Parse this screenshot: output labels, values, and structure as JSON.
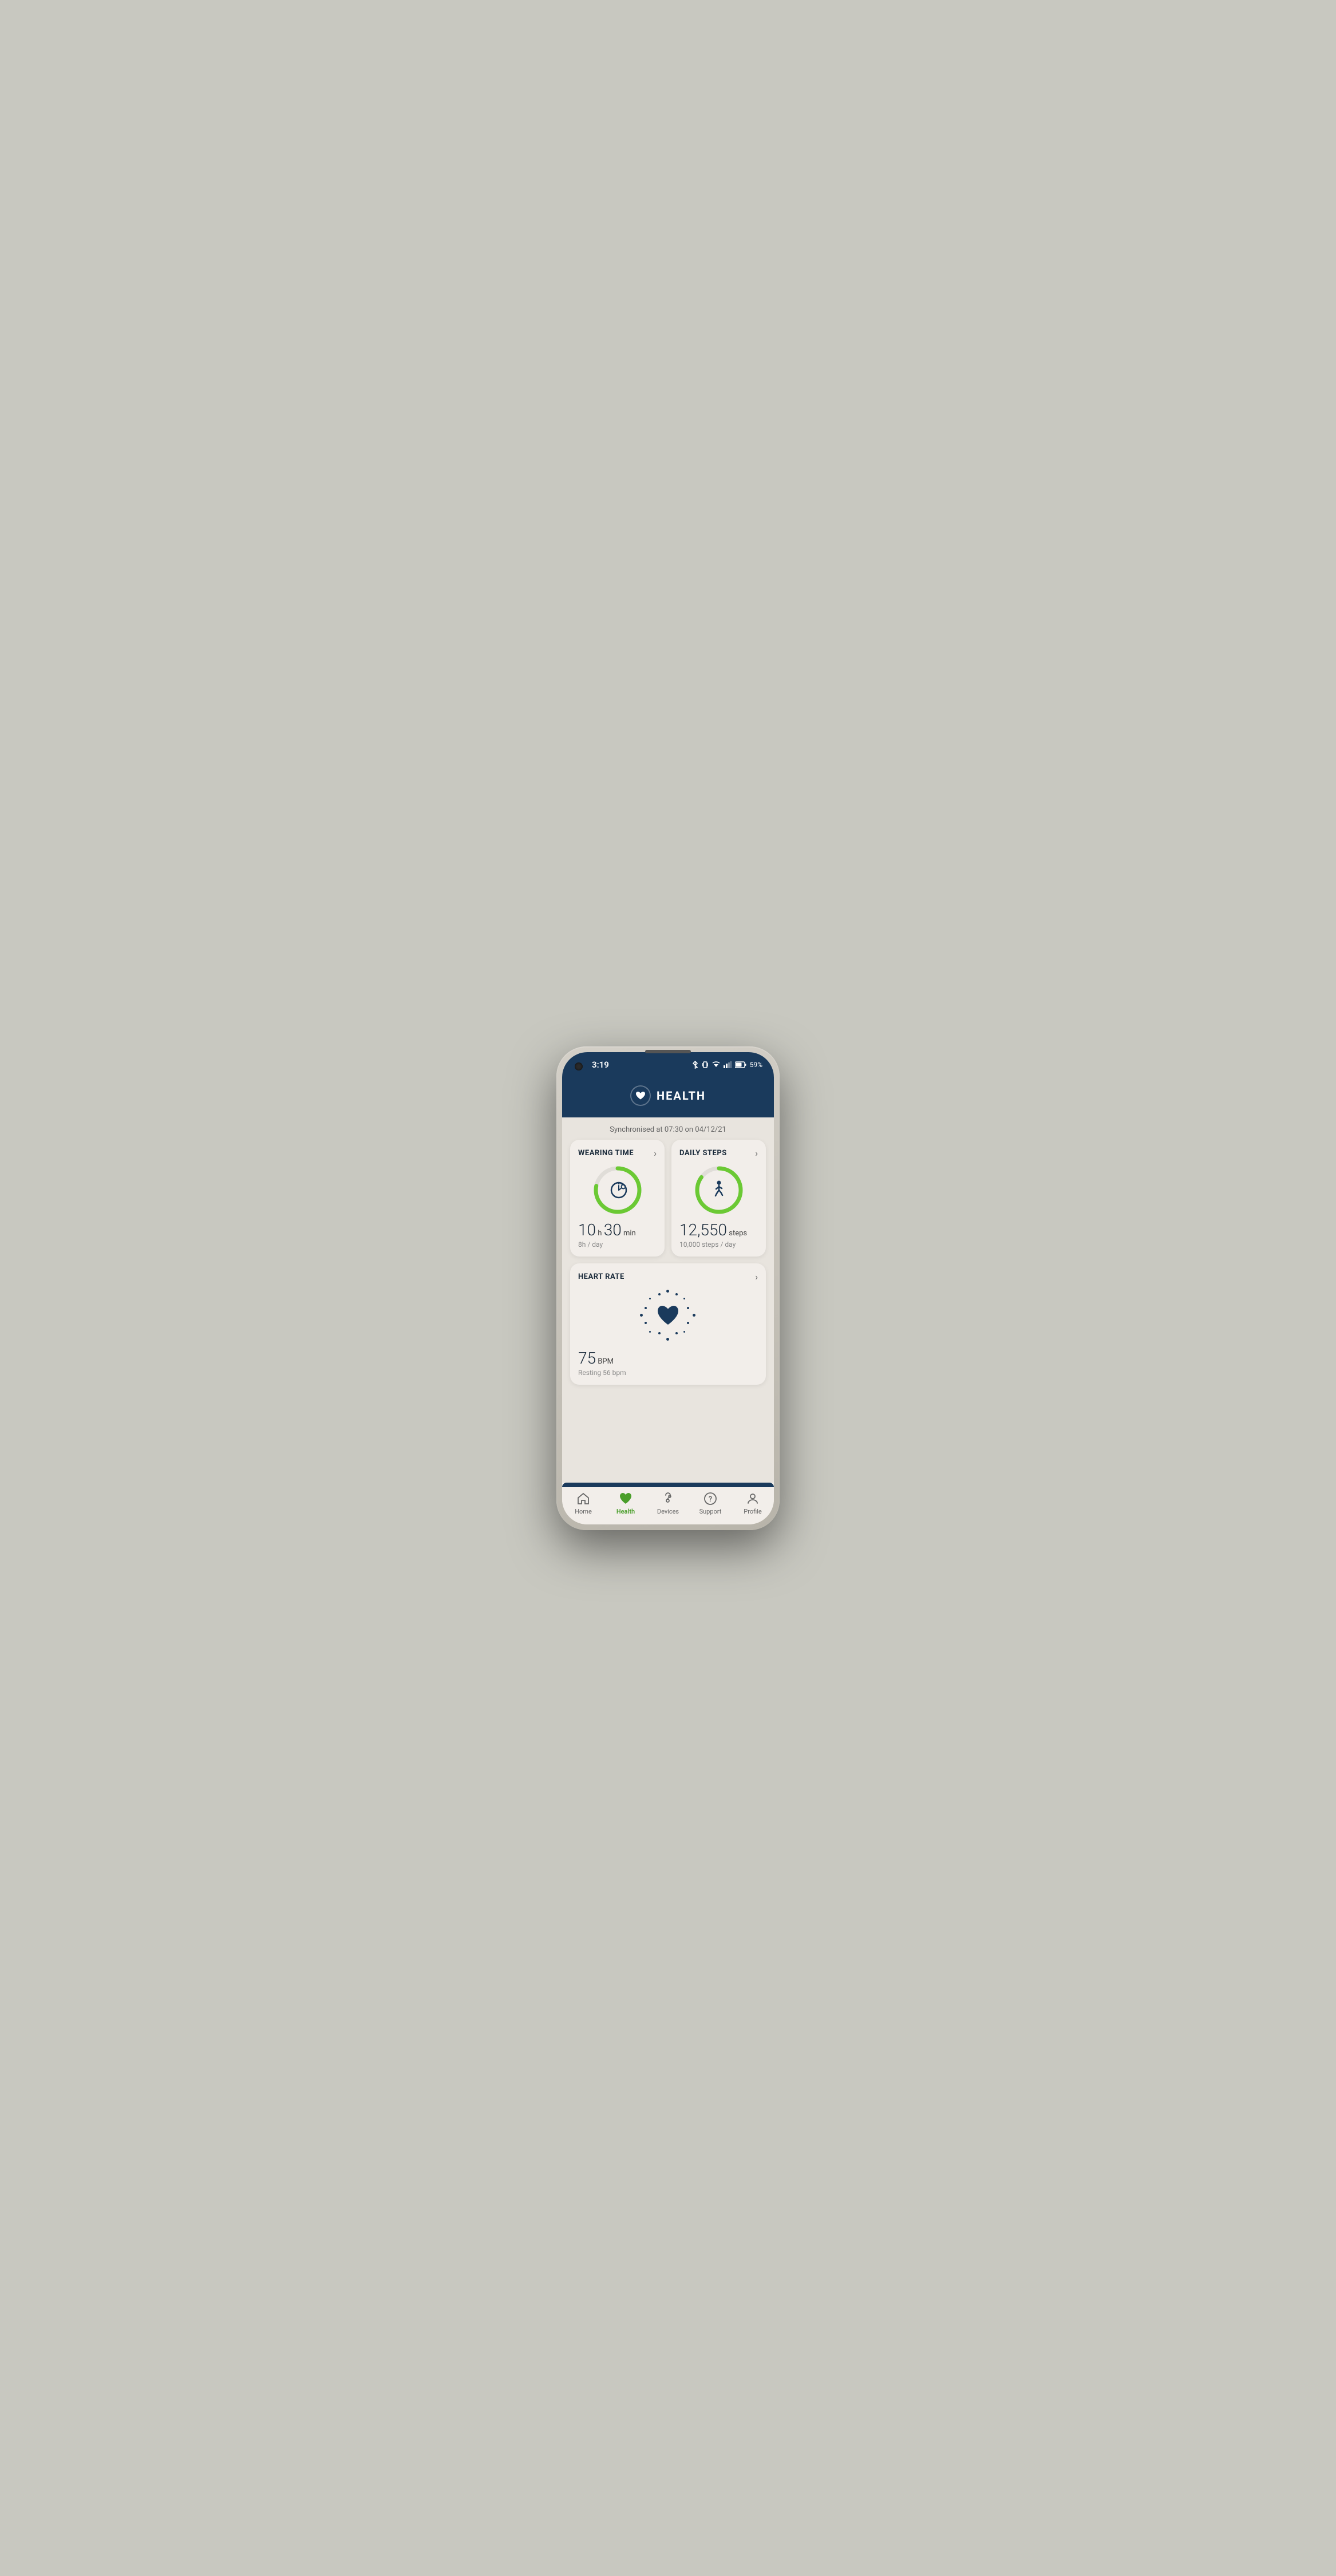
{
  "device": {
    "notch": true,
    "camera": true
  },
  "statusBar": {
    "time": "3:19",
    "battery": "59%"
  },
  "header": {
    "title": "HEALTH"
  },
  "sync": {
    "text": "Synchronised at 07:30 on 04/12/21"
  },
  "cards": {
    "wearingTime": {
      "title": "WEARING TIME",
      "bigNum": "10",
      "unit1": "h",
      "bigNum2": "30",
      "unit2": "min",
      "sub": "8h / day",
      "progress": 0.78
    },
    "dailySteps": {
      "title": "DAILY STEPS",
      "bigNum": "12,550",
      "unit": "steps",
      "sub": "10,000 steps / day",
      "progress": 0.85
    },
    "heartRate": {
      "title": "HEART RATE",
      "bigNum": "75",
      "unit": "BPM",
      "sub": "Resting 56 bpm",
      "progress": 0.6
    }
  },
  "bottomNav": {
    "items": [
      {
        "label": "Home",
        "icon": "home",
        "active": false
      },
      {
        "label": "Health",
        "icon": "health",
        "active": true
      },
      {
        "label": "Devices",
        "icon": "devices",
        "active": false
      },
      {
        "label": "Support",
        "icon": "support",
        "active": false
      },
      {
        "label": "Profile",
        "icon": "profile",
        "active": false
      }
    ]
  }
}
